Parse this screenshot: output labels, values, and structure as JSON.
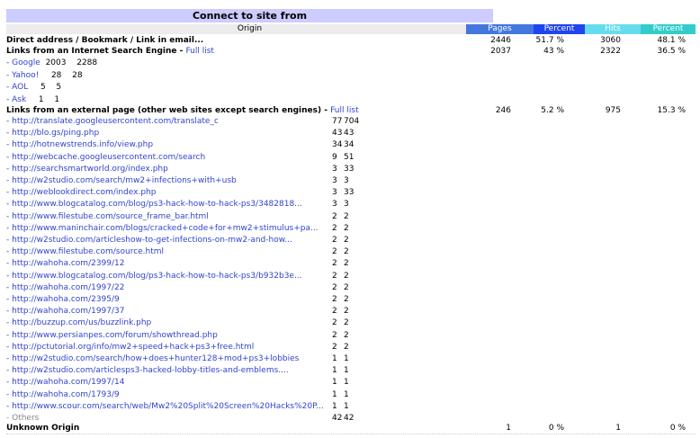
{
  "title": "Connect to site from",
  "header": {
    "origin": "Origin",
    "pages": "Pages",
    "percent1": "Percent",
    "hits": "Hits",
    "percent2": "Percent"
  },
  "direct": {
    "label": "Direct address / Bookmark / Link in email...",
    "pages": "2446",
    "pct": "51.7 %",
    "hits": "3060",
    "hpct": "48.1 %"
  },
  "search": {
    "label": "Links from an Internet Search Engine",
    "link": "Full list",
    "pages": "2037",
    "pct": "43 %",
    "hits": "2322",
    "hpct": "36.5 %",
    "engines": [
      {
        "dash": "- ",
        "name": "Google",
        "pages": "2003",
        "hits": "2288"
      },
      {
        "dash": "- ",
        "name": "Yahoo!",
        "pages": "28",
        "hits": "28"
      },
      {
        "dash": "- ",
        "name": "AOL",
        "pages": "5",
        "hits": "5"
      },
      {
        "dash": "- ",
        "name": "Ask",
        "pages": "1",
        "hits": "1"
      }
    ]
  },
  "external": {
    "label": "Links from an external page (other web sites except search engines)",
    "link": "Full list",
    "pages": "246",
    "pct": "5.2 %",
    "hits": "975",
    "hpct": "15.3 %",
    "items": [
      {
        "url": "- http://translate.googleusercontent.com/translate_c",
        "pages": "77",
        "hits": "704"
      },
      {
        "url": "- http://blo.gs/ping.php",
        "pages": "43",
        "hits": "43"
      },
      {
        "url": "- http://hotnewstrends.info/view.php",
        "pages": "34",
        "hits": "34"
      },
      {
        "url": "- http://webcache.googleusercontent.com/search",
        "pages": "9",
        "hits": "51"
      },
      {
        "url": "- http://searchsmartworld.org/index.php",
        "pages": "3",
        "hits": "33"
      },
      {
        "url": "- http://w2studio.com/search/mw2+infections+with+usb",
        "pages": "3",
        "hits": "3"
      },
      {
        "url": "- http://weblookdirect.com/index.php",
        "pages": "3",
        "hits": "33"
      },
      {
        "url": "- http://www.blogcatalog.com/blog/ps3-hack-how-to-hack-ps3/3482818...",
        "pages": "3",
        "hits": "3"
      },
      {
        "url": "- http://www.filestube.com/source_frame_bar.html",
        "pages": "2",
        "hits": "2"
      },
      {
        "url": "- http://www.maninchair.com/blogs/cracked+code+for+mw2+stimulus+pa...",
        "pages": "2",
        "hits": "2"
      },
      {
        "url": "- http://w2studio.com/articleshow-to-get-infections-on-mw2-and-how...",
        "pages": "2",
        "hits": "2"
      },
      {
        "url": "- http://www.filestube.com/source.html",
        "pages": "2",
        "hits": "2"
      },
      {
        "url": "- http://wahoha.com/2399/12",
        "pages": "2",
        "hits": "2"
      },
      {
        "url": "- http://www.blogcatalog.com/blog/ps3-hack-how-to-hack-ps3/b932b3e...",
        "pages": "2",
        "hits": "2"
      },
      {
        "url": "- http://wahoha.com/1997/22",
        "pages": "2",
        "hits": "2"
      },
      {
        "url": "- http://wahoha.com/2395/9",
        "pages": "2",
        "hits": "2"
      },
      {
        "url": "- http://wahoha.com/1997/37",
        "pages": "2",
        "hits": "2"
      },
      {
        "url": "- http://buzzup.com/us/buzzlink.php",
        "pages": "2",
        "hits": "2"
      },
      {
        "url": "- http://www.persianpes.com/forum/showthread.php",
        "pages": "2",
        "hits": "2"
      },
      {
        "url": "- http://pctutorial.org/info/mw2+speed+hack+ps3+free.html",
        "pages": "2",
        "hits": "2"
      },
      {
        "url": "- http://w2studio.com/search/how+does+hunter128+mod+ps3+lobbies",
        "pages": "1",
        "hits": "1"
      },
      {
        "url": "- http://w2studio.com/articlesps3-hacked-lobby-titles-and-emblems....",
        "pages": "1",
        "hits": "1"
      },
      {
        "url": "- http://wahoha.com/1997/14",
        "pages": "1",
        "hits": "1"
      },
      {
        "url": "- http://wahoha.com/1793/9",
        "pages": "1",
        "hits": "1"
      },
      {
        "url": "- http://www.scour.com/search/web/Mw2%20Split%20Screen%20Hacks%20P...",
        "pages": "1",
        "hits": "1"
      }
    ],
    "others": {
      "label": "- Others",
      "pages": "42",
      "hits": "42"
    }
  },
  "unknown": {
    "label": "Unknown Origin",
    "pages": "1",
    "pct": "0 %",
    "hits": "1",
    "hpct": "0 %"
  }
}
